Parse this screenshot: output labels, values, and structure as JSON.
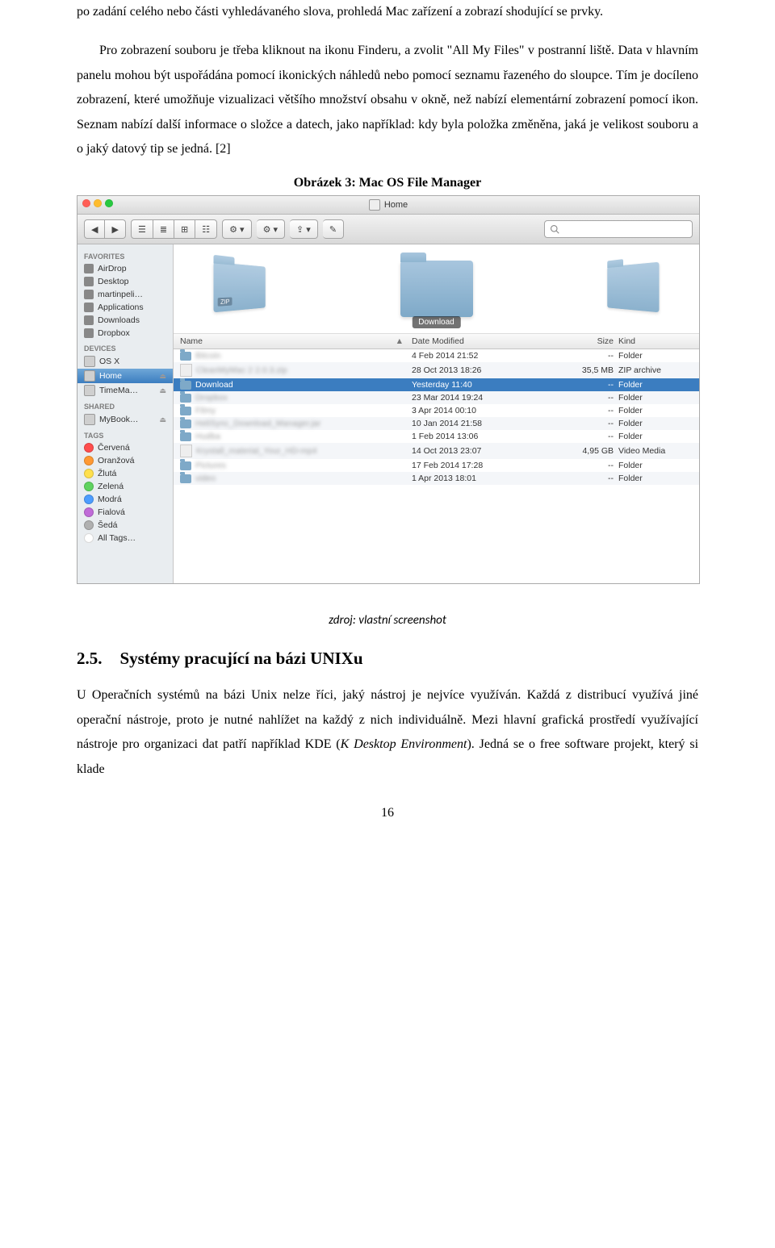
{
  "para1": "po zadání celého nebo části vyhledávaného slova, prohledá Mac zařízení a zobrazí shodující se prvky.",
  "para2": "Pro zobrazení souboru je třeba kliknout na ikonu Finderu, a zvolit \"All My Files\" v postranní liště. Data v hlavním panelu mohou být uspořádána pomocí ikonických náhledů nebo pomocí seznamu řazeného do sloupce. Tím je docíleno zobrazení, které umožňuje vizualizaci většího množství obsahu v okně, než nabízí elementární zobrazení pomocí ikon. Seznam nabízí další informace o složce a datech, jako například: kdy byla položka změněna, jaká je velikost souboru a o jaký datový tip se jedná. [2]",
  "figureCaption": "Obrázek 3: Mac OS File Manager",
  "sourceCaption": "zdroj: vlastní screenshot",
  "heading": {
    "num": "2.5.",
    "title": "Systémy pracující na bázi UNIXu"
  },
  "para3_a": "U Operačních systémů na bázi Unix nelze říci, jaký nástroj je nejvíce využíván. Každá z distribucí využívá jiné operační nástroje, proto je nutné nahlížet na každý z nich individuálně. Mezi hlavní grafická prostředí využívající nástroje pro organizaci dat patří například KDE (",
  "para3_italic": "K Desktop Environment",
  "para3_b": "). Jedná se o free software projekt, který si klade",
  "pageNumber": "16",
  "finder": {
    "windowTitle": "Home",
    "folderLabel": "Download",
    "toolbar": {
      "nav_back": "◀",
      "nav_fwd": "▶",
      "view1": "☰",
      "view2": "≣",
      "view3": "⊞",
      "view4": "☷",
      "arrange": "⚙ ▾",
      "action": "⚙ ▾",
      "share": "⇪ ▾",
      "tags": "✎"
    },
    "search": {
      "placeholder": ""
    },
    "sidebar": {
      "favorites_header": "FAVORITES",
      "favorites": [
        {
          "label": "AirDrop",
          "icon": "airdrop"
        },
        {
          "label": "Desktop",
          "icon": "desktop"
        },
        {
          "label": "martinpeli…",
          "icon": "home"
        },
        {
          "label": "Applications",
          "icon": "apps"
        },
        {
          "label": "Downloads",
          "icon": "downloads"
        },
        {
          "label": "Dropbox",
          "icon": "dropbox"
        }
      ],
      "devices_header": "DEVICES",
      "devices": [
        {
          "label": "OS X",
          "eject": false
        },
        {
          "label": "Home",
          "eject": true,
          "selected": true
        },
        {
          "label": "TimeMa…",
          "eject": true
        }
      ],
      "shared_header": "SHARED",
      "shared": [
        {
          "label": "MyBook…",
          "eject": true
        }
      ],
      "tags_header": "TAGS",
      "tags": [
        {
          "label": "Červená",
          "color": "#ff4d4d"
        },
        {
          "label": "Oranžová",
          "color": "#ff9933"
        },
        {
          "label": "Žlutá",
          "color": "#ffe04d"
        },
        {
          "label": "Zelená",
          "color": "#5fd35f"
        },
        {
          "label": "Modrá",
          "color": "#4d9dff"
        },
        {
          "label": "Fialová",
          "color": "#c06bd8"
        },
        {
          "label": "Šedá",
          "color": "#b0b0b0"
        },
        {
          "label": "All Tags…",
          "color": "#ffffff"
        }
      ]
    },
    "columns": {
      "name": "Name",
      "date": "Date Modified",
      "size": "Size",
      "kind": "Kind",
      "sort": "▲"
    },
    "rows": [
      {
        "name": "Bitcoin",
        "date": "4 Feb 2014 21:52",
        "size": "--",
        "kind": "Folder",
        "type": "folder"
      },
      {
        "name": "CleanMyMac 2 2.0.3.zip",
        "date": "28 Oct 2013 18:26",
        "size": "35,5 MB",
        "kind": "ZIP archive",
        "type": "file"
      },
      {
        "name": "Download",
        "date": "Yesterday 11:40",
        "size": "--",
        "kind": "Folder",
        "type": "folder",
        "selected": true
      },
      {
        "name": "Dropbox",
        "date": "23 Mar 2014 19:24",
        "size": "--",
        "kind": "Folder",
        "type": "folder"
      },
      {
        "name": "Filmy",
        "date": "3 Apr 2014 00:10",
        "size": "--",
        "kind": "Folder",
        "type": "folder"
      },
      {
        "name": "HeliSync_Download_Manager.jar",
        "date": "10 Jan 2014 21:58",
        "size": "--",
        "kind": "Folder",
        "type": "folder"
      },
      {
        "name": "Hudba",
        "date": "1 Feb 2014 13:06",
        "size": "--",
        "kind": "Folder",
        "type": "folder"
      },
      {
        "name": "Krystall_material_Your_HD-mp4",
        "date": "14 Oct 2013 23:07",
        "size": "4,95 GB",
        "kind": "Video Media",
        "type": "file"
      },
      {
        "name": "Pictures",
        "date": "17 Feb 2014 17:28",
        "size": "--",
        "kind": "Folder",
        "type": "folder"
      },
      {
        "name": "video",
        "date": "1 Apr 2013 18:01",
        "size": "--",
        "kind": "Folder",
        "type": "folder"
      }
    ]
  }
}
